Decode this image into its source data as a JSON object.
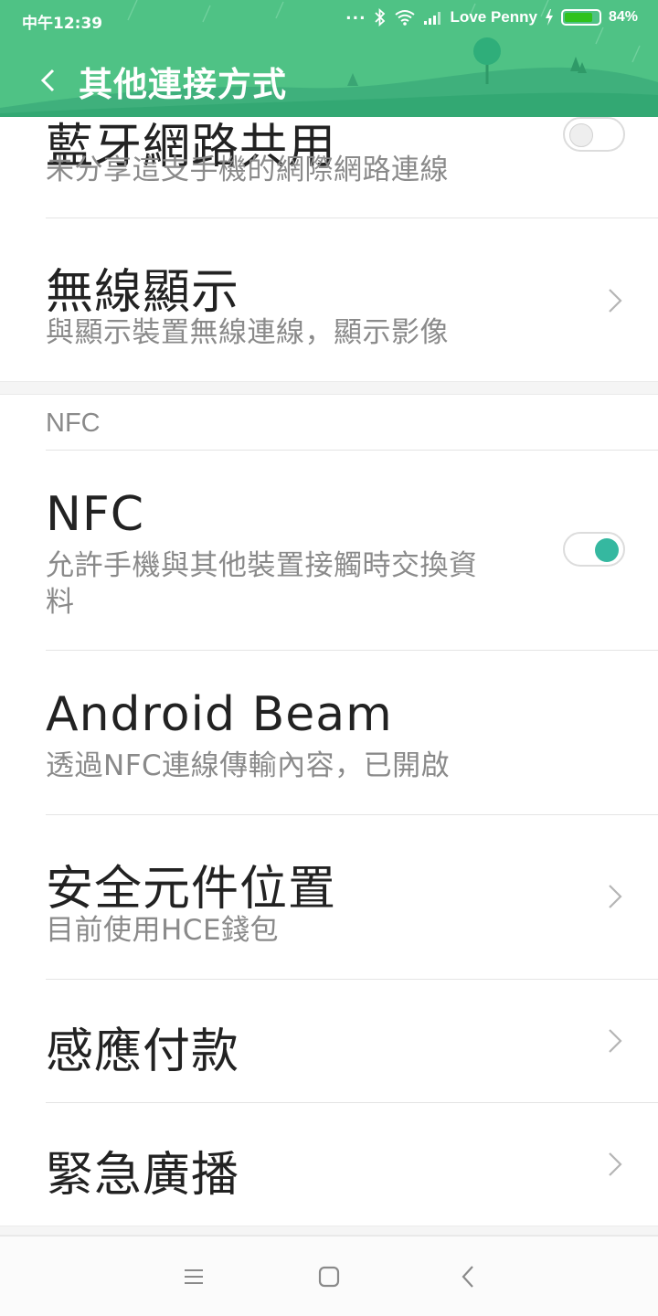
{
  "status_bar": {
    "time": "中午12:39",
    "dots": "...",
    "carrier": "Love Penny",
    "battery_percent": "84%",
    "battery_level": 0.84
  },
  "header": {
    "title": "其他連接方式",
    "back_icon": "chevron-left-icon"
  },
  "items": [
    {
      "title": "藍牙網路共用",
      "subtitle": "未分享這支手機的網際網路連線",
      "control": "toggle",
      "toggle_on": false
    },
    {
      "title": "無線顯示",
      "subtitle": "與顯示裝置無線連線，顯示影像",
      "control": "chevron"
    }
  ],
  "nfc_section": {
    "header": "NFC",
    "items": [
      {
        "title": "NFC",
        "subtitle_line1": "允許手機與其他裝置接觸時交換資",
        "subtitle_line2": "料",
        "control": "toggle",
        "toggle_on": true
      },
      {
        "title": "Android Beam",
        "subtitle": "透過NFC連線傳輸內容，已開啟",
        "control": "none"
      },
      {
        "title": "安全元件位置",
        "subtitle": "目前使用HCE錢包",
        "control": "chevron"
      },
      {
        "title": "感應付款",
        "control": "chevron"
      },
      {
        "title": "緊急廣播",
        "control": "chevron"
      }
    ]
  },
  "nav_bar": {
    "menu_icon": "menu-icon",
    "home_icon": "home-icon",
    "back_icon": "back-icon"
  },
  "colors": {
    "header_green": "#4fc285",
    "toggle_on": "#35b8a0",
    "battery_fill": "#2fc21c"
  }
}
